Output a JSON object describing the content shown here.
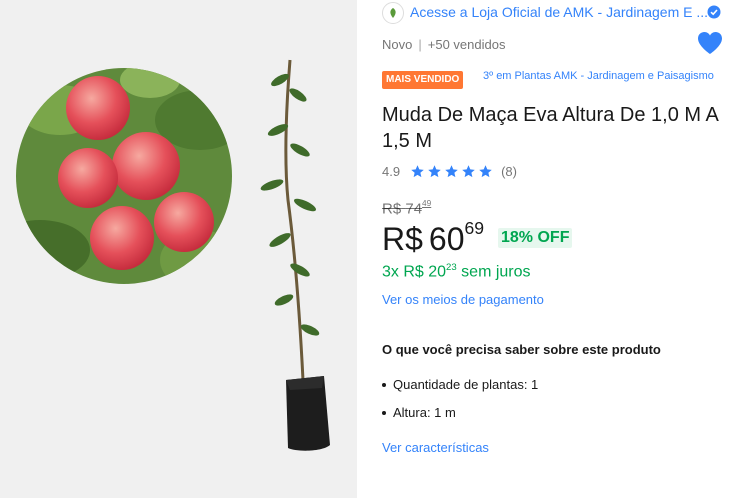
{
  "store": {
    "link_text": "Acesse a Loja Oficial de AMK - Jardinagem E ...",
    "logo_icon": "store-logo-icon",
    "verified_icon": "verified-check-icon"
  },
  "subtitle": {
    "condition": "Novo",
    "separator": "|",
    "sold": "+50 vendidos"
  },
  "badge": {
    "label": "MAIS VENDIDO",
    "rank_text": "3º em Plantas AMK - Jardinagem e Paisagismo"
  },
  "product": {
    "title": "Muda De Maça Eva Altura De 1,0 M A 1,5 M"
  },
  "rating": {
    "score": "4.9",
    "stars": 5,
    "count": "(8)"
  },
  "price": {
    "currency": "R$",
    "original_integer": "74",
    "original_cents": "49",
    "integer": "60",
    "cents": "69",
    "discount": "18% OFF"
  },
  "installments": {
    "prefix": "3x R$ 20",
    "cents": "23",
    "suffix": " sem juros"
  },
  "payment_link": "Ver os meios de pagamento",
  "features": {
    "title": "O que você precisa saber sobre este produto",
    "items": [
      "Quantidade de plantas: 1",
      "Altura: 1 m"
    ]
  },
  "characteristics_link": "Ver características",
  "colors": {
    "link": "#3483fa",
    "green": "#00a650",
    "badge": "#ff7733",
    "heart": "#3483fa"
  }
}
